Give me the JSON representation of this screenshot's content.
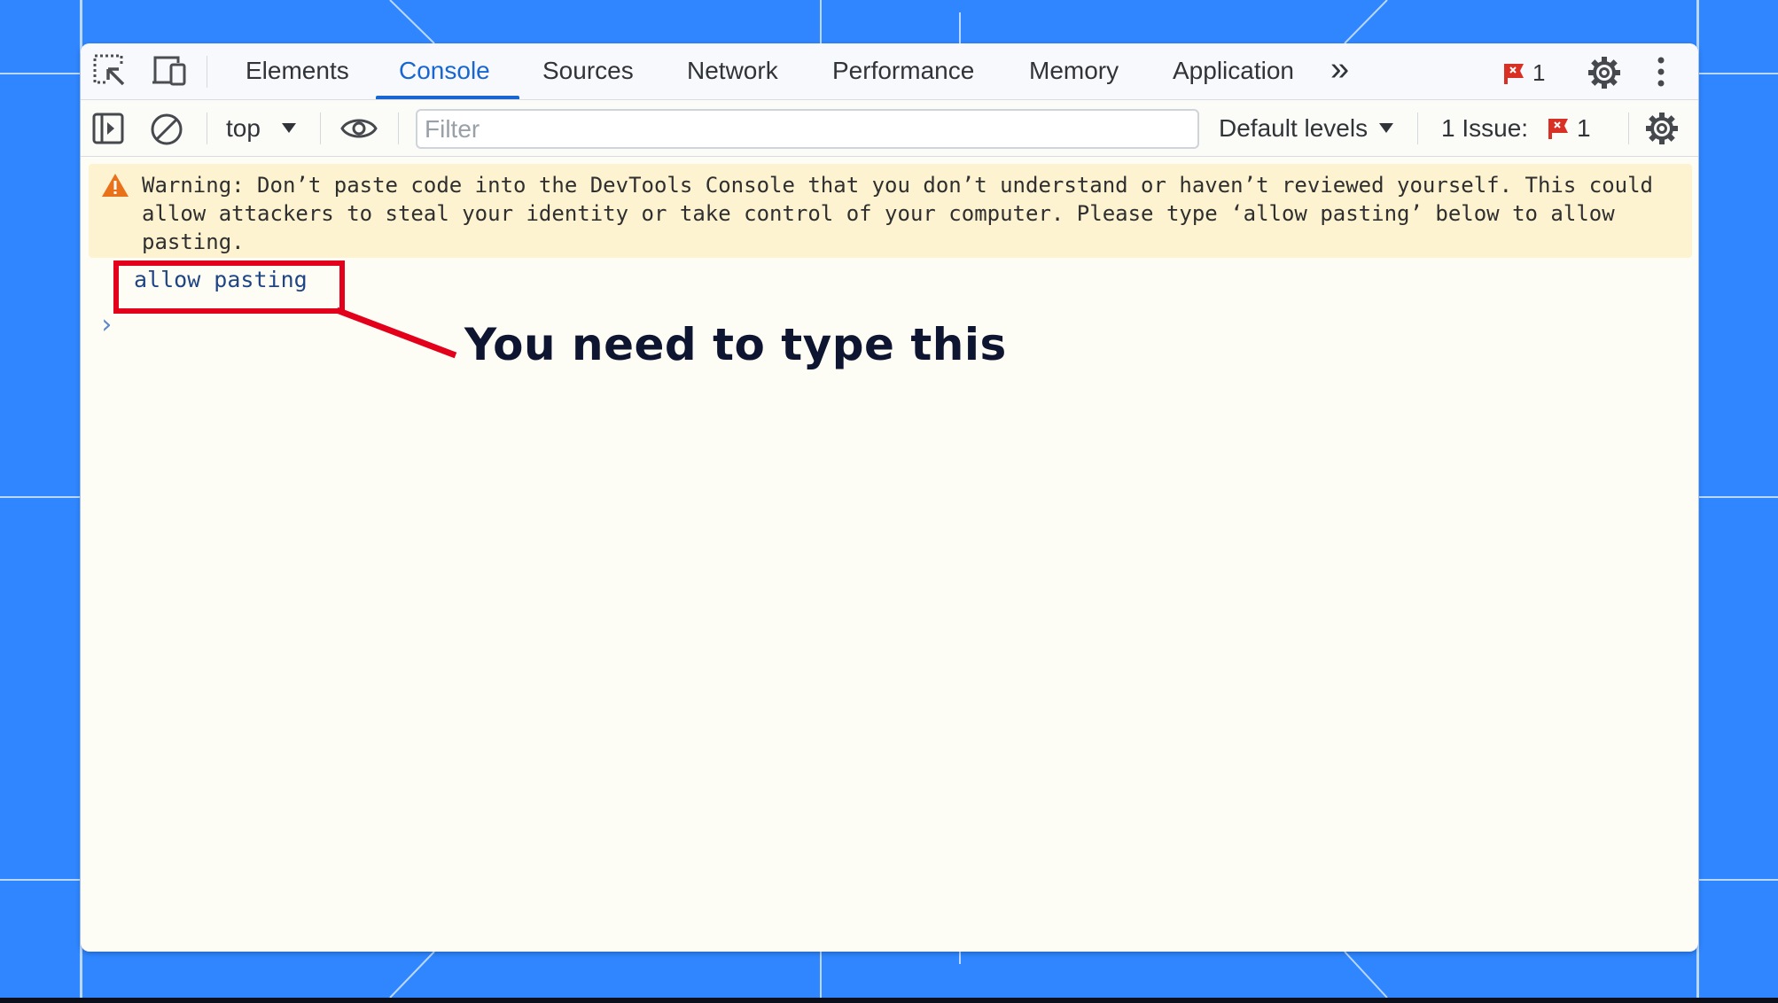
{
  "tabs": [
    {
      "label": "Elements",
      "active": false
    },
    {
      "label": "Console",
      "active": true
    },
    {
      "label": "Sources",
      "active": false
    },
    {
      "label": "Network",
      "active": false
    },
    {
      "label": "Performance",
      "active": false
    },
    {
      "label": "Memory",
      "active": false
    },
    {
      "label": "Application",
      "active": false
    }
  ],
  "tabbar": {
    "more_tabs_label": "»",
    "error_count": "1",
    "icons": [
      "inspect-element-icon",
      "device-toolbar-icon",
      "more-tabs-icon",
      "error-flag-icon",
      "settings-gear-icon",
      "kebab-menu-icon"
    ]
  },
  "toolbar": {
    "context": "top",
    "filter_placeholder": "Filter",
    "levels": "Default levels",
    "issues_label": "1 Issue:",
    "issues_count": "1",
    "icons": [
      "sidebar-toggle-icon",
      "clear-console-icon",
      "eye-icon",
      "settings-gear-icon"
    ]
  },
  "console": {
    "warning": "Warning: Don’t paste code into the DevTools Console that you don’t understand or haven’t reviewed yourself. This could allow attackers to steal your identity or take control of your computer. Please type ‘allow pasting’ below to allow pasting.",
    "entry": "allow pasting",
    "prompt_symbol": "›"
  },
  "annotation": {
    "text": "You need to type this",
    "color": "#e3001b"
  },
  "colors": {
    "background": "#2f86ff",
    "accent": "#1766d1",
    "warning_bg": "#fdf3d1",
    "error": "#d93025"
  }
}
